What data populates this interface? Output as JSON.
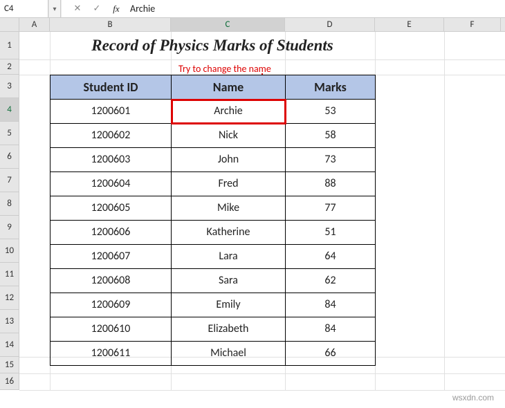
{
  "formula_bar": {
    "cell_ref": "C4",
    "fx_label": "fx",
    "cancel_glyph": "✕",
    "enter_glyph": "✓",
    "dropdown_glyph": "▾",
    "formula_value": "Archie"
  },
  "columns": [
    "A",
    "B",
    "C",
    "D",
    "E",
    "F"
  ],
  "selected_column": "C",
  "rows": [
    "1",
    "2",
    "3",
    "4",
    "5",
    "6",
    "7",
    "8",
    "9",
    "10",
    "11",
    "12",
    "13",
    "14",
    "15",
    "16"
  ],
  "selected_row": "4",
  "title": "Record of Physics Marks of Students",
  "annotation_text": "Try to change the name",
  "headers": {
    "student_id": "Student ID",
    "name": "Name",
    "marks": "Marks"
  },
  "data_rows": [
    {
      "id": "1200601",
      "name": "Archie",
      "marks": "53"
    },
    {
      "id": "1200602",
      "name": "Nick",
      "marks": "58"
    },
    {
      "id": "1200603",
      "name": "John",
      "marks": "73"
    },
    {
      "id": "1200604",
      "name": "Fred",
      "marks": "88"
    },
    {
      "id": "1200605",
      "name": "Mike",
      "marks": "77"
    },
    {
      "id": "1200606",
      "name": "Katherine",
      "marks": "51"
    },
    {
      "id": "1200607",
      "name": "Lara",
      "marks": "64"
    },
    {
      "id": "1200608",
      "name": "Sara",
      "marks": "62"
    },
    {
      "id": "1200609",
      "name": "Emily",
      "marks": "84"
    },
    {
      "id": "1200610",
      "name": "Elizabeth",
      "marks": "84"
    },
    {
      "id": "1200611",
      "name": "Michael",
      "marks": "66"
    }
  ],
  "watermark": "wsxdn.com"
}
